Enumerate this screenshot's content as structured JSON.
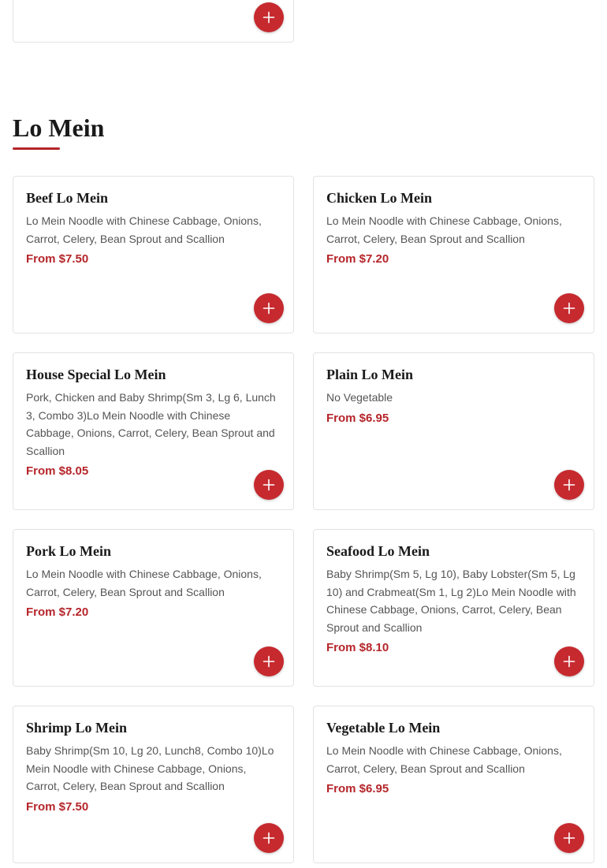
{
  "section": {
    "title": "Lo Mein"
  },
  "items": [
    {
      "name": "Beef Lo Mein",
      "description": "Lo Mein Noodle with Chinese Cabbage, Onions, Carrot, Celery, Bean Sprout and Scallion",
      "price": "From $7.50"
    },
    {
      "name": "Chicken Lo Mein",
      "description": "Lo Mein Noodle with Chinese Cabbage, Onions, Carrot, Celery, Bean Sprout and Scallion",
      "price": "From $7.20"
    },
    {
      "name": "House Special Lo Mein",
      "description": "Pork, Chicken and Baby Shrimp(Sm 3, Lg 6, Lunch 3, Combo 3)Lo Mein Noodle with Chinese Cabbage, Onions, Carrot, Celery, Bean Sprout and Scallion",
      "price": "From $8.05"
    },
    {
      "name": "Plain Lo Mein",
      "description": "No Vegetable",
      "price": "From $6.95"
    },
    {
      "name": "Pork Lo Mein",
      "description": "Lo Mein Noodle with Chinese Cabbage, Onions, Carrot, Celery, Bean Sprout and Scallion",
      "price": "From $7.20"
    },
    {
      "name": "Seafood Lo Mein",
      "description": "Baby Shrimp(Sm 5, Lg 10), Baby Lobster(Sm 5, Lg 10) and Crabmeat(Sm 1, Lg 2)Lo Mein Noodle with Chinese Cabbage, Onions, Carrot, Celery, Bean Sprout and Scallion",
      "price": "From $8.10"
    },
    {
      "name": "Shrimp Lo Mein",
      "description": "Baby Shrimp(Sm 10, Lg 20, Lunch8, Combo 10)Lo Mein Noodle with Chinese Cabbage, Onions, Carrot, Celery, Bean Sprout and Scallion",
      "price": "From $7.50"
    },
    {
      "name": "Vegetable Lo Mein",
      "description": "Lo Mein Noodle with Chinese Cabbage, Onions, Carrot, Celery, Bean Sprout and Scallion",
      "price": "From $6.95"
    }
  ],
  "icons": {
    "add": "plus-icon"
  },
  "colors": {
    "accent": "#c62a2f",
    "price": "#b5252a",
    "border": "#e3e3e3"
  }
}
